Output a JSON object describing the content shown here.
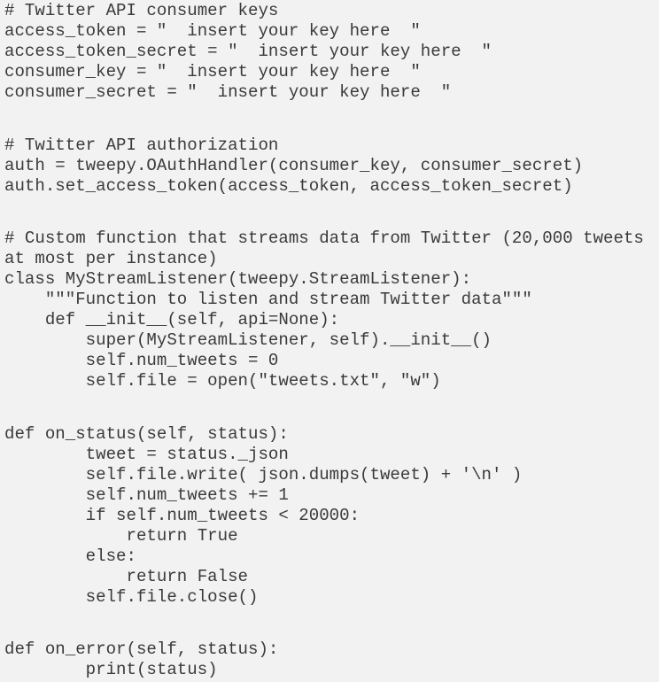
{
  "code_blocks": [
    {
      "lines": [
        "# Twitter API consumer keys",
        "access_token = \"  insert your key here  \"",
        "access_token_secret = \"  insert your key here  \"",
        "consumer_key = \"  insert your key here  \"",
        "consumer_secret = \"  insert your key here  \""
      ]
    },
    {
      "lines": [
        "# Twitter API authorization",
        "auth = tweepy.OAuthHandler(consumer_key, consumer_secret)",
        "auth.set_access_token(access_token, access_token_secret)"
      ]
    },
    {
      "lines": [
        "# Custom function that streams data from Twitter (20,000 tweets",
        "at most per instance)",
        "class MyStreamListener(tweepy.StreamListener):",
        "    \"\"\"Function to listen and stream Twitter data\"\"\"",
        "    def __init__(self, api=None):",
        "        super(MyStreamListener, self).__init__()",
        "        self.num_tweets = 0",
        "        self.file = open(\"tweets.txt\", \"w\")"
      ]
    },
    {
      "lines": [
        "def on_status(self, status):",
        "        tweet = status._json",
        "        self.file.write( json.dumps(tweet) + '\\n' )",
        "        self.num_tweets += 1",
        "        if self.num_tweets < 20000:",
        "            return True",
        "        else:",
        "            return False",
        "        self.file.close()"
      ]
    },
    {
      "lines": [
        "def on_error(self, status):",
        "        print(status)"
      ]
    }
  ]
}
